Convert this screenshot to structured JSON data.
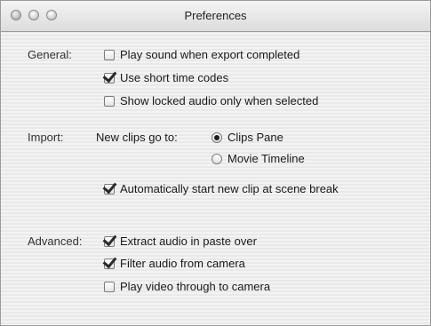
{
  "window": {
    "title": "Preferences"
  },
  "general": {
    "label": "General:",
    "options": [
      {
        "label": "Play sound when export completed",
        "checked": false
      },
      {
        "label": "Use short time codes",
        "checked": true
      },
      {
        "label": "Show locked audio only when selected",
        "checked": false
      }
    ]
  },
  "import": {
    "label": "Import:",
    "new_clips_label": "New clips go to:",
    "radio_options": [
      {
        "label": "Clips Pane",
        "selected": true
      },
      {
        "label": "Movie Timeline",
        "selected": false
      }
    ],
    "auto_start": {
      "label": "Automatically start new clip at scene break",
      "checked": true
    }
  },
  "advanced": {
    "label": "Advanced:",
    "options": [
      {
        "label": "Extract audio in paste over",
        "checked": true
      },
      {
        "label": "Filter audio from camera",
        "checked": true
      },
      {
        "label": "Play video through to camera",
        "checked": false
      }
    ]
  }
}
